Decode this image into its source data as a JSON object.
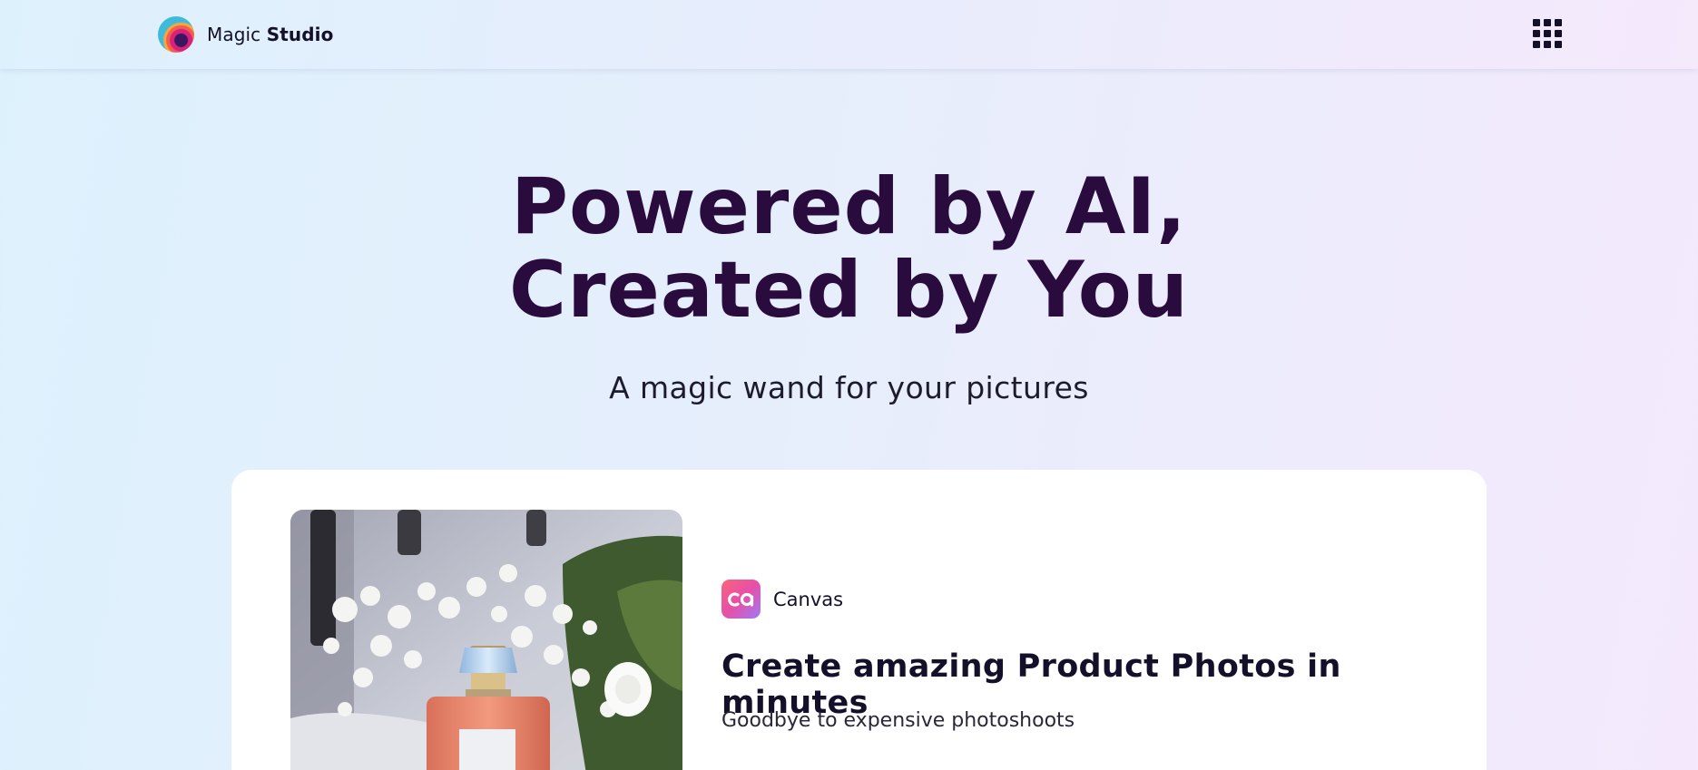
{
  "header": {
    "brand_light": "Magic",
    "brand_bold": "Studio",
    "logo_icon": "magic-studio-logo-icon",
    "apps_icon": "apps-grid-icon"
  },
  "hero": {
    "title_line1": "Powered by AI,",
    "title_line2": "Created by You",
    "subtitle": "A magic wand for your pictures"
  },
  "feature_card": {
    "image_alt": "perfume bottle with white flowers",
    "product_icon": "canvas-app-icon",
    "product_name": "Canvas",
    "title": "Create amazing Product Photos in minutes",
    "description": "Goodbye to expensive photoshoots"
  },
  "colors": {
    "title": "#2a0b3d",
    "text": "#14102a",
    "card": "#ffffff",
    "accent_pink": "#e74fa8",
    "accent_purple": "#a07af5"
  }
}
